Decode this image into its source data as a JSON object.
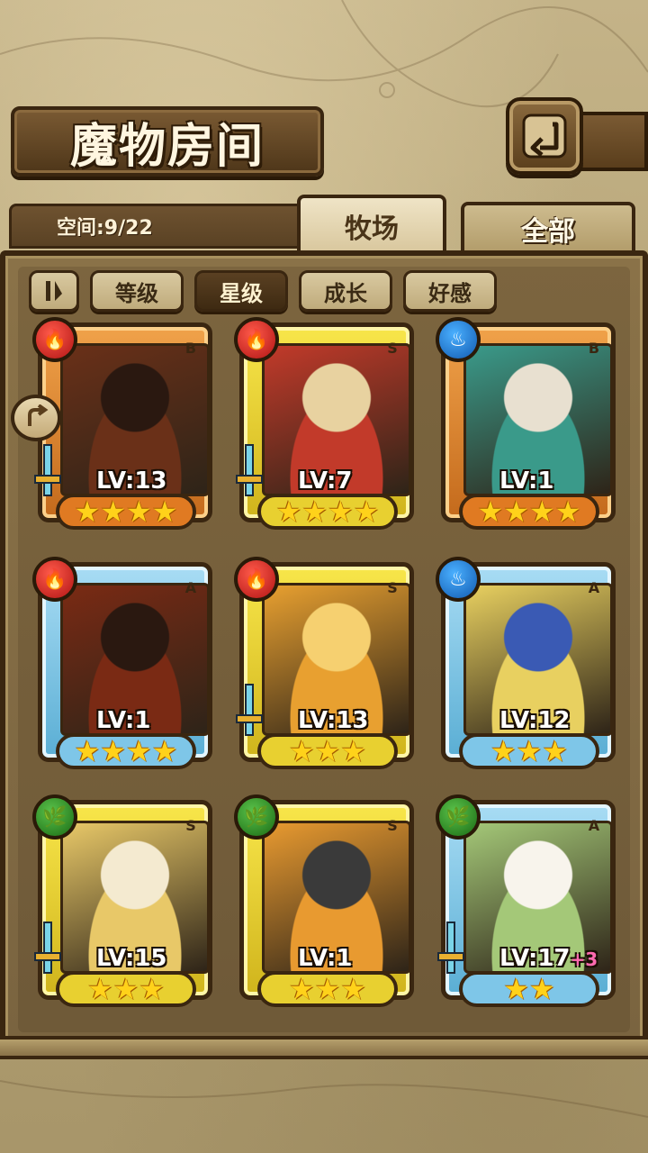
{
  "header": {
    "title": "魔物房间",
    "back_icon": "return-arrow-icon"
  },
  "space": {
    "label": "空间:9/22"
  },
  "tabs": [
    {
      "label": "牧场",
      "active": true
    },
    {
      "label": "全部",
      "active": false
    }
  ],
  "sort": {
    "toggle_icon": "pause-sort-icon",
    "options": [
      {
        "label": "等级",
        "active": false
      },
      {
        "label": "星级",
        "active": true
      },
      {
        "label": "成长",
        "active": false
      },
      {
        "label": "好感",
        "active": false
      }
    ]
  },
  "side_tab_icon": "curved-arrow-icon",
  "colors": {
    "rank_B": "#f0a24a",
    "rank_S": "#f8e64a",
    "rank_A": "#a8dcf4",
    "fire": "#c81e1e",
    "water": "#1a6ac8",
    "wood": "#2a8a1e"
  },
  "monsters": [
    {
      "rank": "B",
      "element": "fire",
      "element_glyph": "🔥",
      "level": "LV:13",
      "plus": "",
      "stars": "★★★★",
      "weapon": true,
      "palette": [
        "#2a1810",
        "#6a3018"
      ]
    },
    {
      "rank": "S",
      "element": "fire",
      "element_glyph": "🔥",
      "level": "LV:7",
      "plus": "",
      "stars": "★★★★",
      "weapon": true,
      "palette": [
        "#e8d2a0",
        "#c23a2a"
      ]
    },
    {
      "rank": "B",
      "element": "water",
      "element_glyph": "♨",
      "level": "LV:1",
      "plus": "",
      "stars": "★★★★",
      "weapon": false,
      "palette": [
        "#e8e0d0",
        "#3a9a8a"
      ]
    },
    {
      "rank": "A",
      "element": "fire",
      "element_glyph": "🔥",
      "level": "LV:1",
      "plus": "",
      "stars": "★★★★",
      "weapon": false,
      "palette": [
        "#2a1810",
        "#7a2a14"
      ]
    },
    {
      "rank": "S",
      "element": "fire",
      "element_glyph": "🔥",
      "level": "LV:13",
      "plus": "",
      "stars": "★★★",
      "weapon": true,
      "palette": [
        "#f6d070",
        "#e8a030"
      ]
    },
    {
      "rank": "A",
      "element": "water",
      "element_glyph": "♨",
      "level": "LV:12",
      "plus": "",
      "stars": "★★★",
      "weapon": false,
      "palette": [
        "#3a5ab4",
        "#e8d060"
      ]
    },
    {
      "rank": "S",
      "element": "wood",
      "element_glyph": "🌿",
      "level": "LV:15",
      "plus": "",
      "stars": "★★★",
      "weapon": true,
      "palette": [
        "#f4ead0",
        "#e8c868"
      ]
    },
    {
      "rank": "S",
      "element": "wood",
      "element_glyph": "🌿",
      "level": "LV:1",
      "plus": "",
      "stars": "★★★",
      "weapon": false,
      "palette": [
        "#3a3a3a",
        "#e89a30"
      ]
    },
    {
      "rank": "A",
      "element": "wood",
      "element_glyph": "🌿",
      "level": "LV:17",
      "plus": "+3",
      "stars": "★★",
      "weapon": true,
      "palette": [
        "#f8f4ec",
        "#a4c878"
      ]
    }
  ]
}
